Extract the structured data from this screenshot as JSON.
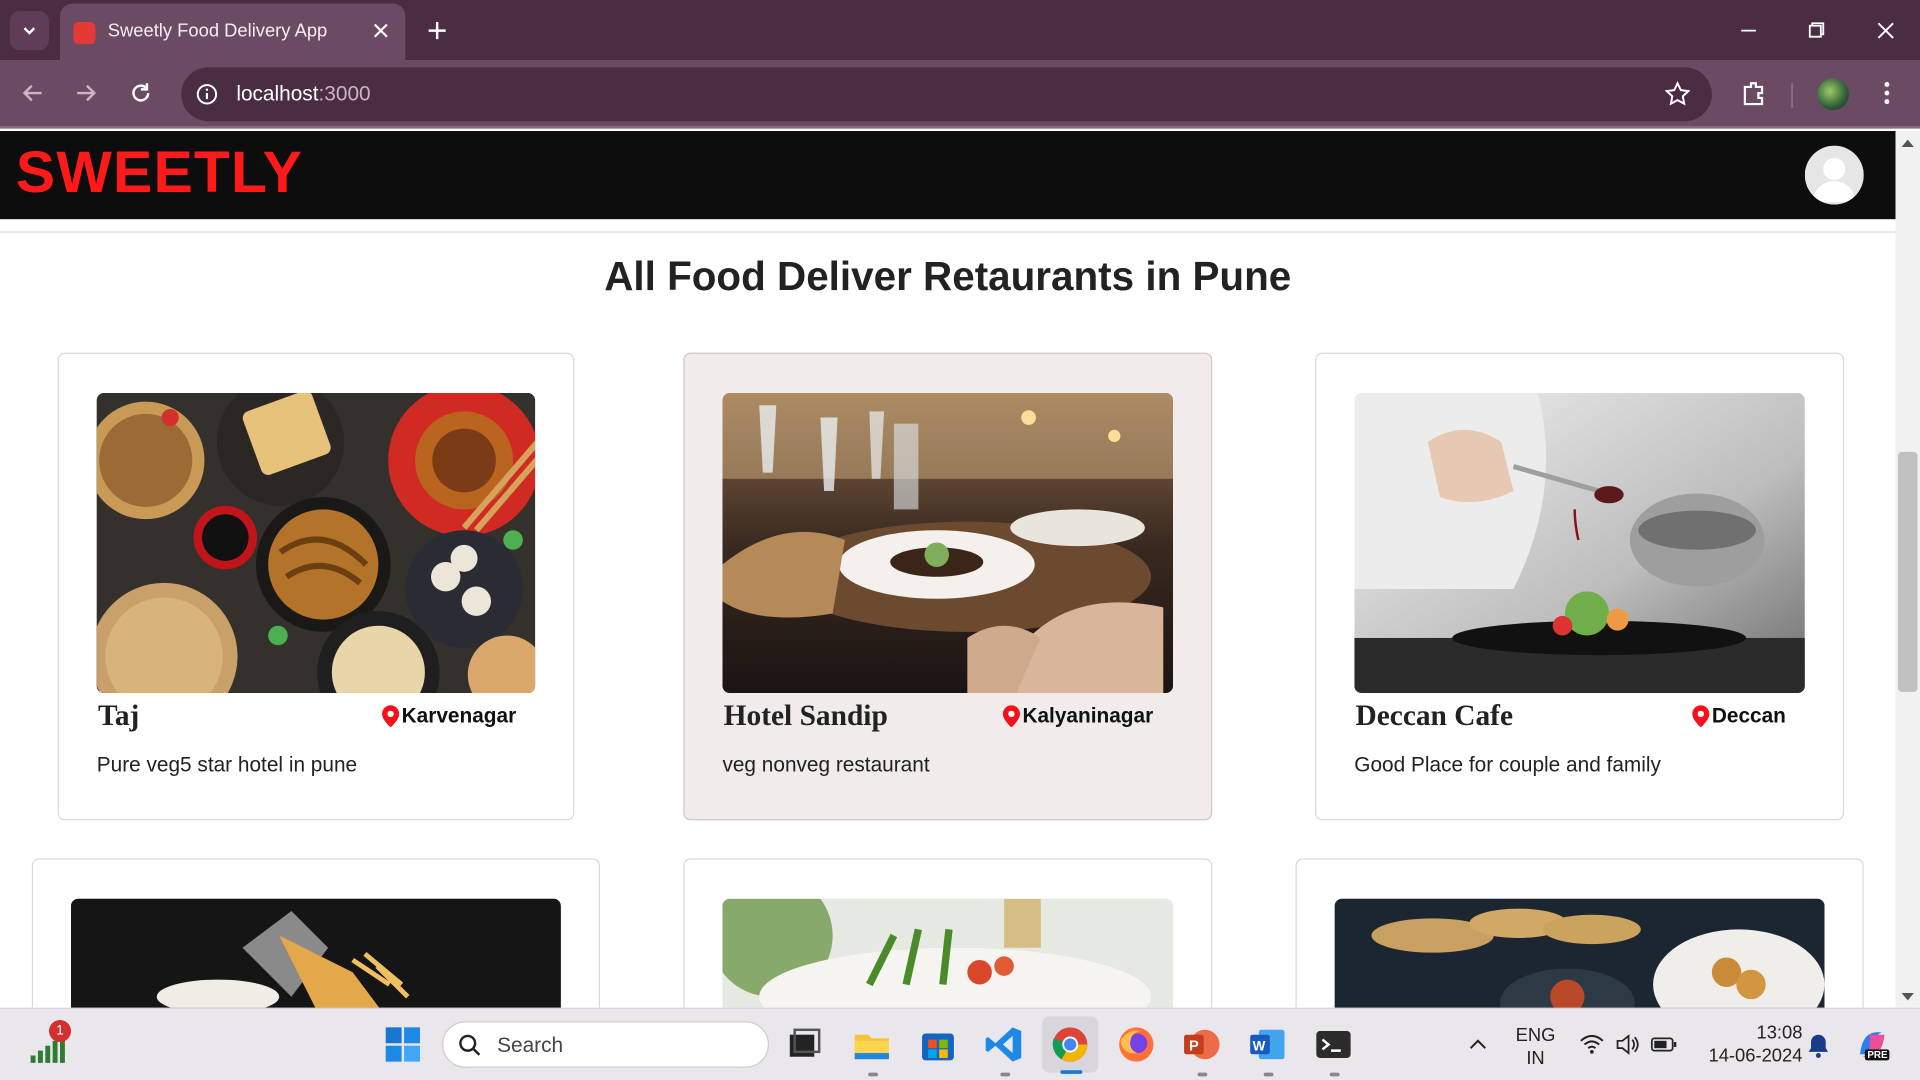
{
  "browser": {
    "tab_title": "Sweetly Food Delivery App",
    "url_host": "localhost",
    "url_port": ":3000"
  },
  "site": {
    "logo": "SWEETLY",
    "heading": "All Food Deliver Retaurants in Pune"
  },
  "restaurants": [
    {
      "name": "Taj",
      "location": "Karvenagar",
      "description": "Pure veg5 star hotel in pune"
    },
    {
      "name": "Hotel Sandip",
      "location": "Kalyaninagar",
      "description": "veg nonveg restaurant"
    },
    {
      "name": "Deccan Cafe",
      "location": "Deccan",
      "description": "Good Place for couple and family"
    }
  ],
  "taskbar": {
    "search_placeholder": "Search",
    "widget_badge": "1",
    "lang_top": "ENG",
    "lang_bottom": "IN",
    "time": "13:08",
    "date": "14-06-2024",
    "copilot_badge": "PRE"
  },
  "colors": {
    "brand_red": "#ff1a1a",
    "header_bg": "#0d0d0d",
    "browser_frame": "#4a2c43",
    "browser_toolbar": "#6b4a63"
  }
}
